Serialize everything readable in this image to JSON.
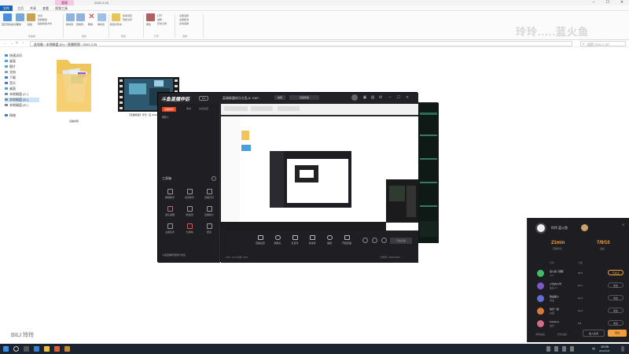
{
  "explorer": {
    "title": "2022.2.25",
    "context_tab": "管理",
    "tabs": [
      "文件",
      "主页",
      "共享",
      "查看",
      "视频工具"
    ],
    "ribbon": {
      "buttons": [
        "固定到快速访问",
        "复制",
        "粘贴",
        "剪切",
        "复制路径",
        "粘贴快捷方式",
        "移动到",
        "复制到",
        "删除",
        "重命名",
        "新建文件夹",
        "新建项目",
        "轻松访问",
        "属性",
        "打开",
        "编辑",
        "历史记录",
        "全部选择",
        "全部取消",
        "反向选择"
      ],
      "groups": [
        "剪贴板",
        "组织",
        "新建",
        "打开",
        "选择"
      ]
    },
    "address": "此电脑 › 本地磁盘 (D:) › 直播视频 › 2022.2.25",
    "search_placeholder": "搜索\"2022.2.25\"",
    "nav": [
      "快速访问",
      "桌面",
      "图片",
      "文档",
      "下载",
      "音乐",
      "桌面",
      "本地磁盘 (C:)",
      "本地磁盘 (D:)",
      "本地磁盘 (E:)",
      "网络"
    ],
    "files": [
      {
        "name": "直播剪辑"
      },
      {
        "name": "【英雄联盟】玲玲...直 2022/2/25 10:0..."
      }
    ],
    "watermark": "玲玲.....蓝火鱼"
  },
  "stream": {
    "logo": "斗鱼直播伴侣",
    "logo_badge": "5.0",
    "room_title": "英雄联盟欢乐大乱斗 7087..",
    "room_btn": "编辑",
    "category": "英雄联盟",
    "left_tabs": [
      "直播场景",
      "素材",
      "房间设置"
    ],
    "scene": "场景 1",
    "tools_title": "工具箱",
    "tools": [
      "弹幕助手",
      "房管助手",
      "直播日历",
      "送礼提醒",
      "粉丝团",
      "直播统计",
      "主播任务",
      "礼物墙",
      "更多"
    ],
    "notice": "斗鱼直播伴侣用户协议",
    "bottom_items": [
      "直播设置",
      "摄像头",
      "麦克风",
      "多媒体",
      "美颜",
      "开始直播"
    ],
    "live_btn": "开始直播",
    "status_left": "CPU: 11%  内存: 40%",
    "status_right": "分辨率: 1920x1080"
  },
  "popup": {
    "name": "玲玲.蓝火鱼",
    "stats": [
      {
        "value": "21min",
        "label": "直播时长"
      },
      {
        "value": "7/9/10",
        "label": "战绩"
      }
    ],
    "col_headers": [
      "玩家",
      "分数"
    ],
    "rows": [
      {
        "name": "蓝火鱼 | 国服",
        "sub": "LV.1",
        "score": "26.8",
        "action": "已关注"
      },
      {
        "name": "小玲的小号",
        "sub": "铂金 IV",
        "score": "15.2",
        "action": "关注"
      },
      {
        "name": "我是路人",
        "sub": "黄金",
        "score": "14.0",
        "action": "关注"
      },
      {
        "name": "快乐一起",
        "sub": "白银",
        "score": "12.3",
        "action": "关注"
      },
      {
        "name": "Soloking",
        "sub": "钻石",
        "score": "9.8",
        "action": "关注"
      }
    ],
    "footer_left": "本局战绩",
    "footer_mid": "历史战绩",
    "btn_secondary": "加入房间",
    "btn_primary": "观战"
  },
  "watermark_bl": "BILI 玲玲",
  "taskbar": {
    "lang": "中",
    "time": "10:05",
    "date": "2022/2/25"
  }
}
